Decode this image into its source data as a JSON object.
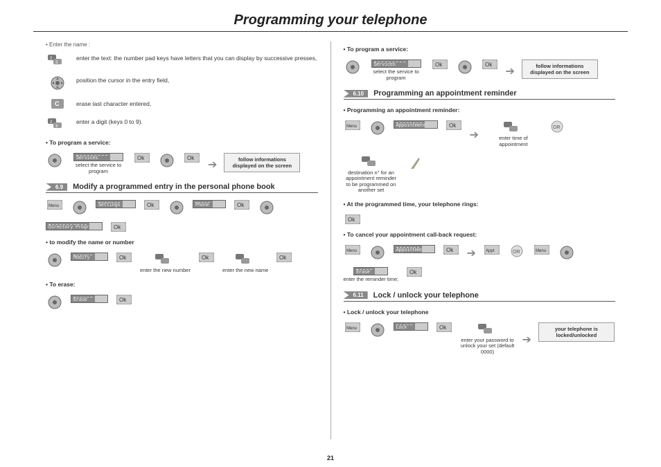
{
  "title": "Programming your telephone",
  "page_number": "21",
  "left": {
    "footnote": "• Enter the name :",
    "entry_rows": [
      {
        "icon": "keypad-keys-icon",
        "text": "enter the text: the number pad keys have letters that you can display by successive presses,"
      },
      {
        "icon": "navigator-icon",
        "text": "position the cursor in the entry field,"
      },
      {
        "icon": "c-key-icon",
        "text": "erase last character entered,"
      },
      {
        "icon": "keypad-keys-icon",
        "text": "enter a digit (keys 0 to 9)."
      }
    ],
    "program_service_label": "To program a service:",
    "program_service_flow": {
      "display1": "Services",
      "caption": "select the service to program",
      "info": "follow informations displayed on the screen"
    },
    "sec69": {
      "num": "6.9",
      "title": "Modify a programmed entry in the personal phone book",
      "flow_labels": {
        "d1": "Settings",
        "d2": "Phone",
        "d3": "Directory Program"
      },
      "modify_label": "to modify the name or number",
      "modify_flow": {
        "d": "Modify",
        "c1": "enter the new number",
        "c2": "enter the new name"
      },
      "erase_label": "To erase:",
      "erase_flow": {
        "d": "Erase"
      }
    }
  },
  "right": {
    "program_service_label": "To program a service:",
    "program_service_flow": {
      "display1": "Services",
      "caption": "select the service to program",
      "info": "follow informations displayed on the screen"
    },
    "sec610": {
      "num": "6.10",
      "title": "Programming an appointment reminder",
      "sub1": "Programming an appointment reminder:",
      "flow1": {
        "d": "Appointment",
        "c1": "enter time of appointment",
        "c2": "destination n° for an appointment reminder to be programmed on another set"
      },
      "sub2": "At the programmed time, your telephone rings:",
      "sub3": "To cancel your appointment call-back request:",
      "flow3": {
        "d1": "Appointment",
        "d2": "Erase",
        "c": "enter the reminder time;"
      },
      "or": "OR"
    },
    "sec611": {
      "num": "6.11",
      "title": "Lock / unlock your telephone",
      "sub": "Lock / unlock your telephone",
      "flow": {
        "d": "Lock",
        "c": "enter your password to unlock your set (default 0000)",
        "info": "your telephone is locked/unlocked"
      }
    }
  }
}
